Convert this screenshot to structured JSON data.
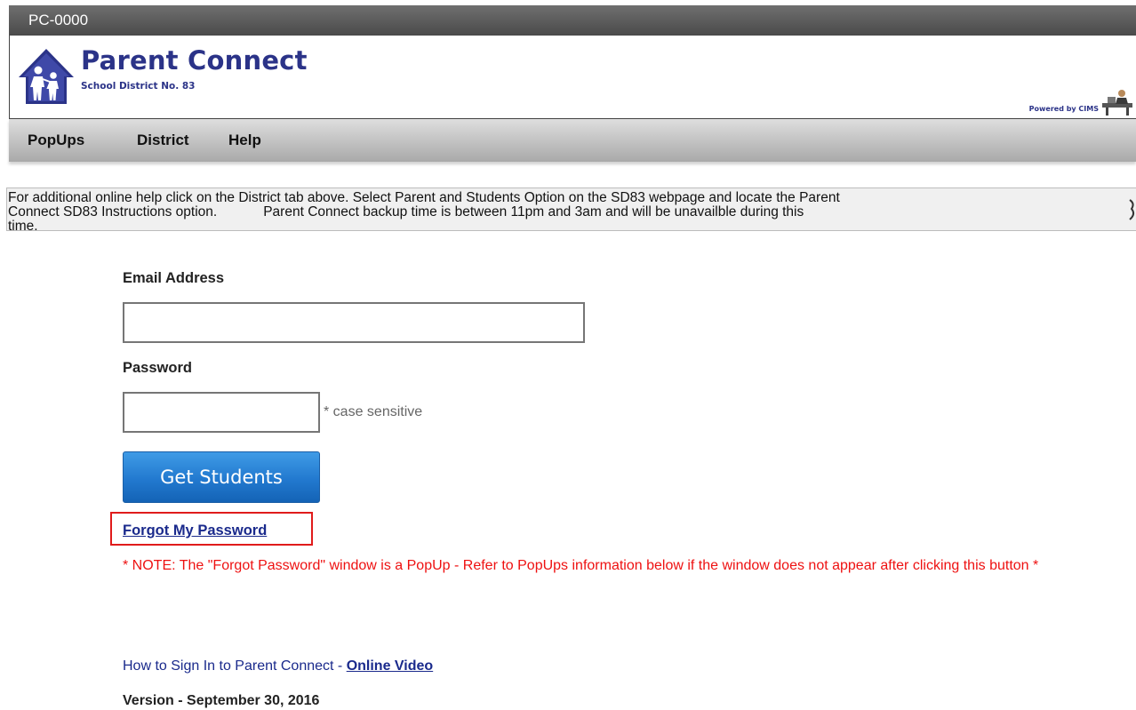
{
  "header": {
    "code": "PC-0000",
    "brand_title": "Parent Connect",
    "brand_subtitle": "School District No. 83",
    "powered_by": "Powered by CIMS"
  },
  "nav": {
    "items": [
      {
        "label": "PopUps"
      },
      {
        "label": "District"
      },
      {
        "label": "Help"
      }
    ]
  },
  "notice": {
    "line1": "For additional online help click on the District tab above. Select Parent and Students Option on the SD83 webpage and locate the Parent",
    "line2a": "Connect SD83 Instructions option.",
    "line2b": "Parent Connect backup time is between 11pm and 3am and will be unavailble during this",
    "line3": "time."
  },
  "form": {
    "email_label": "Email Address",
    "email_value": "",
    "password_label": "Password",
    "password_value": "",
    "password_hint": "* case sensitive",
    "submit_label": "Get Students",
    "forgot_label": "Forgot My Password",
    "note": "* NOTE: The \"Forgot Password\" window is a PopUp - Refer to PopUps information below if the window does not appear after clicking this button *"
  },
  "footer": {
    "howto_text": "How to Sign In to Parent Connect - ",
    "howto_link": "Online Video",
    "version": "Version - September 30, 2016"
  },
  "colors": {
    "brand_blue": "#2b3388",
    "button_blue": "#2279cf",
    "note_red": "#ee1111",
    "highlight_red": "#e01b1b",
    "link_blue": "#1a2a8c"
  }
}
